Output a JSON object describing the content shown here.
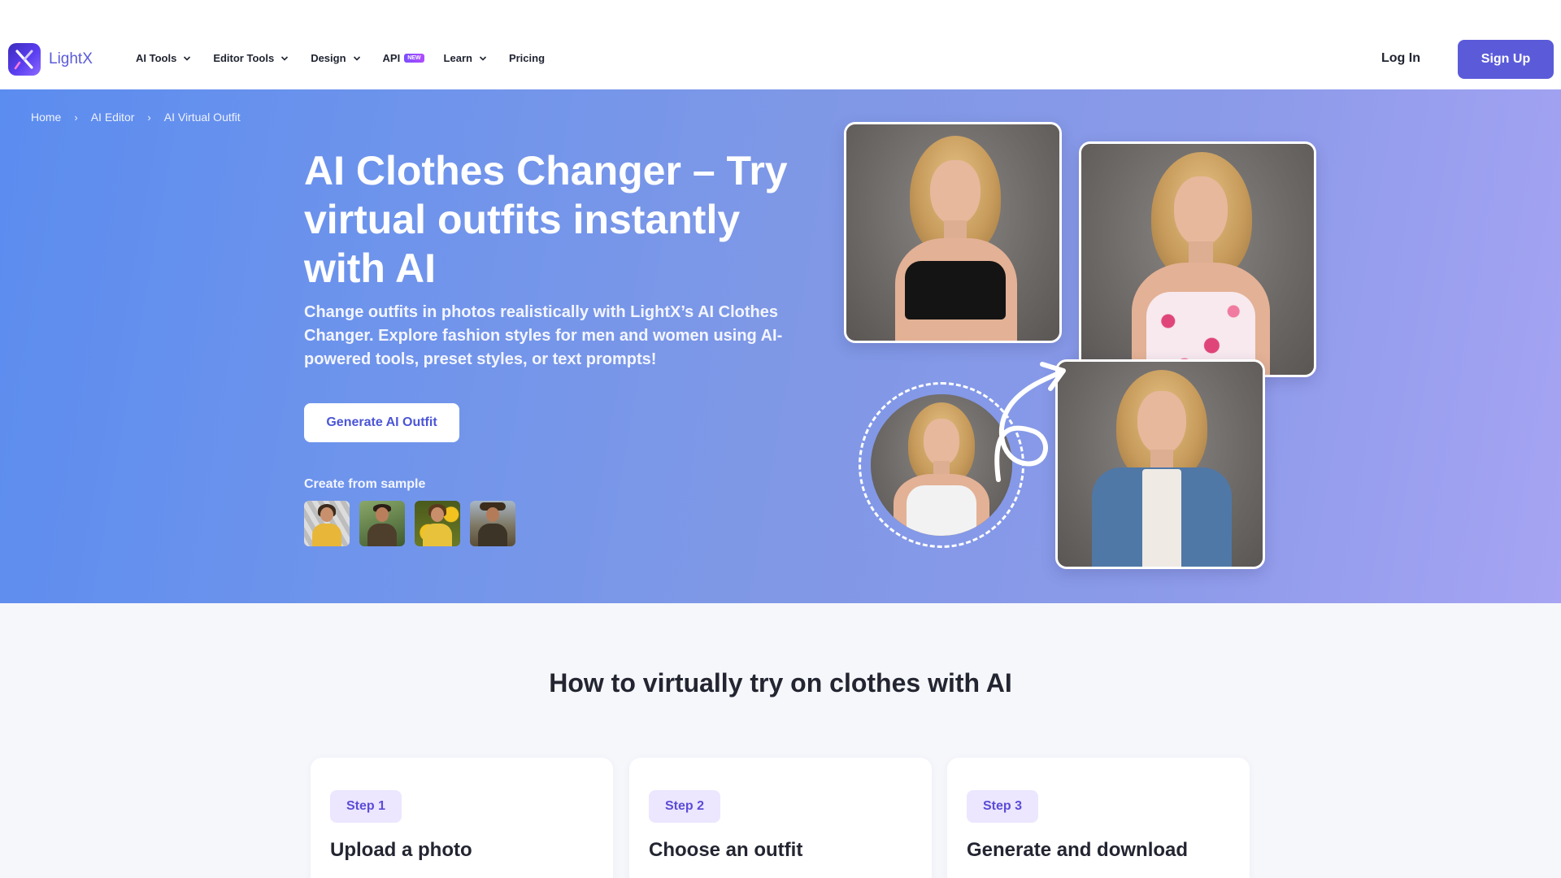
{
  "header": {
    "brand": "LightX",
    "nav": [
      {
        "label": "AI Tools",
        "has_dropdown": true
      },
      {
        "label": "Editor Tools",
        "has_dropdown": true
      },
      {
        "label": "Design",
        "has_dropdown": true
      },
      {
        "label": "API",
        "badge": "NEW",
        "has_dropdown": false
      },
      {
        "label": "Learn",
        "has_dropdown": true
      },
      {
        "label": "Pricing",
        "has_dropdown": false
      }
    ],
    "login": "Log In",
    "signup": "Sign Up"
  },
  "breadcrumb": [
    "Home",
    "AI Editor",
    "AI Virtual Outfit"
  ],
  "hero": {
    "title": "AI Clothes Changer – Try virtual outfits instantly with AI",
    "subtitle": "Change outfits in photos realistically with LightX’s AI Clothes Changer. Explore fashion styles for men and women using AI-powered tools, preset styles, or text prompts!",
    "cta": "Generate AI Outfit",
    "sample_label": "Create from sample",
    "samples": [
      {
        "icon": "sample-woman-yellow-dress"
      },
      {
        "icon": "sample-man-jacket"
      },
      {
        "icon": "sample-woman-sunflowers"
      },
      {
        "icon": "sample-man-hat"
      }
    ],
    "showcase": {
      "original": "white tank top",
      "outfits": [
        "black crop top",
        "floral pink top",
        "denim jacket"
      ]
    }
  },
  "howto": {
    "title": "How to virtually try on clothes with AI",
    "steps": [
      {
        "badge": "Step 1",
        "title": "Upload a photo"
      },
      {
        "badge": "Step 2",
        "title": "Choose an outfit"
      },
      {
        "badge": "Step 3",
        "title": "Generate and download"
      }
    ]
  },
  "colors": {
    "brand": "#5b5bd9",
    "hero_start": "#5b8cef",
    "hero_end": "#a6a4f3",
    "step_badge_bg": "#ece6ff",
    "step_badge_text": "#5b4cd6"
  }
}
